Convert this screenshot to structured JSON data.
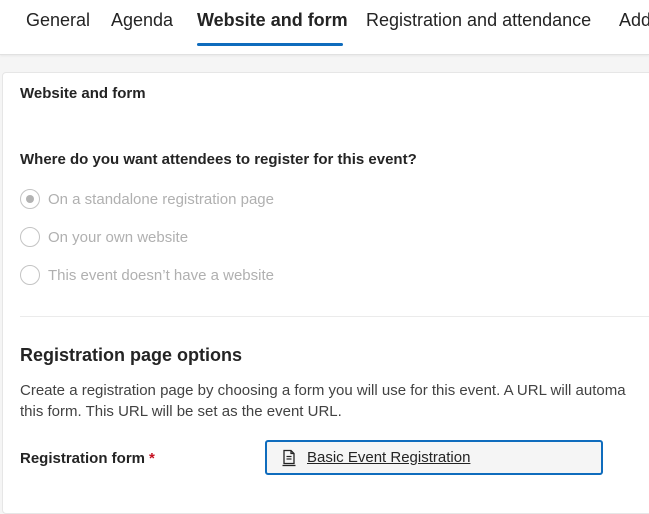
{
  "tabs": [
    {
      "label": "General"
    },
    {
      "label": "Agenda"
    },
    {
      "label": "Website and form",
      "active": true
    },
    {
      "label": "Registration and attendance"
    },
    {
      "label": "Add"
    }
  ],
  "section": {
    "title": "Website and form",
    "question": "Where do you want attendees to register for this event?",
    "options": [
      {
        "label": "On a standalone registration page",
        "selected": true
      },
      {
        "label": "On your own website",
        "selected": false
      },
      {
        "label": "This event doesn’t have a website",
        "selected": false
      }
    ]
  },
  "registration_options": {
    "title": "Registration page options",
    "description_line1": "Create a registration page by choosing a form you will use for this event. A URL will automa",
    "description_line2": "this form. This URL will be set as the event URL.",
    "form_label": "Registration form",
    "required_marker": "*",
    "form_value": "Basic Event Registration"
  },
  "colors": {
    "accent": "#0f6cbd",
    "required": "#c50f1f"
  },
  "icons": {
    "lookup": "form-document-icon"
  }
}
